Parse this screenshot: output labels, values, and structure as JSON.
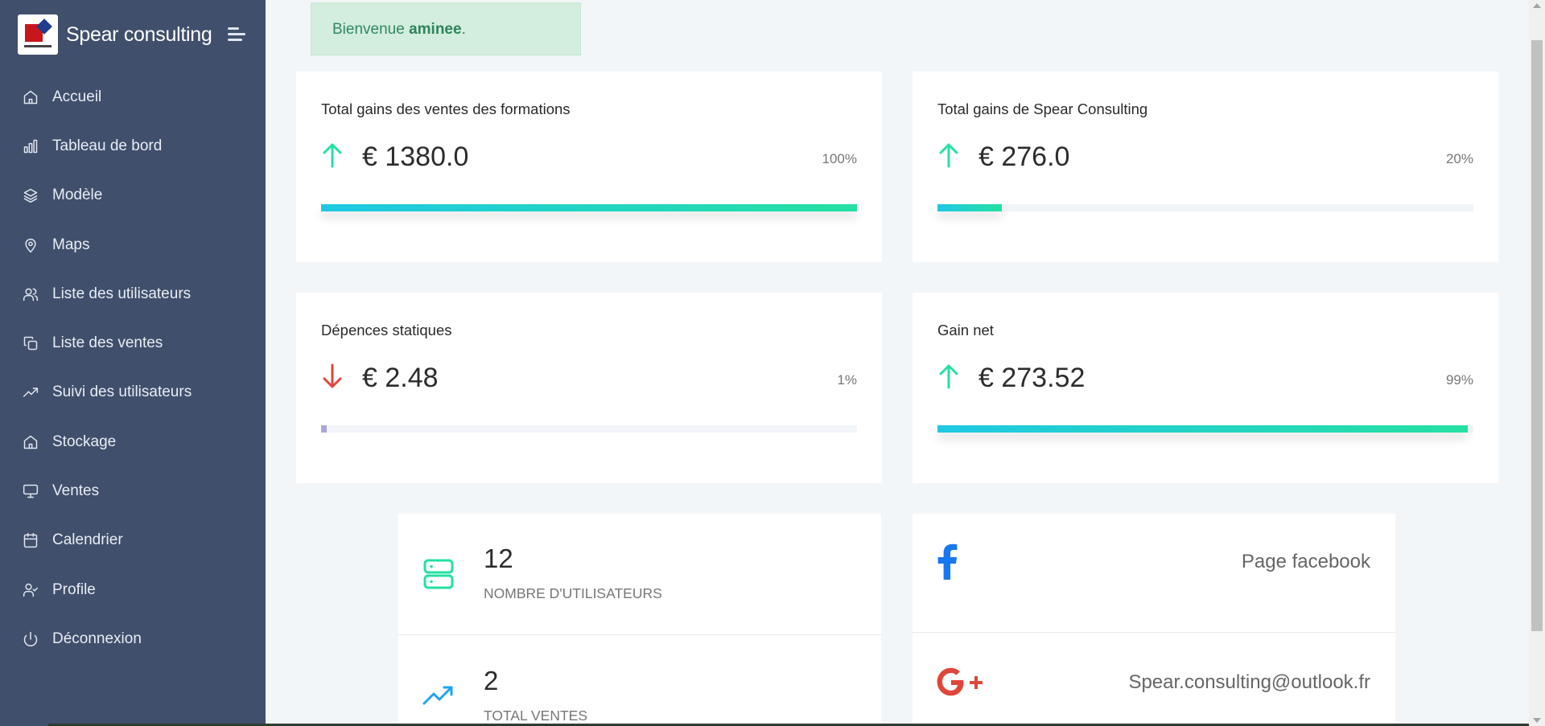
{
  "brand": {
    "name": "Spear consulting"
  },
  "sidebar": {
    "items": [
      {
        "label": "Accueil",
        "icon": "home-icon"
      },
      {
        "label": "Tableau de bord",
        "icon": "bar-chart-icon"
      },
      {
        "label": "Modèle",
        "icon": "layers-icon"
      },
      {
        "label": "Maps",
        "icon": "map-pin-icon"
      },
      {
        "label": "Liste des utilisateurs",
        "icon": "users-icon"
      },
      {
        "label": "Liste des ventes",
        "icon": "copy-icon"
      },
      {
        "label": "Suivi des utilisateurs",
        "icon": "trending-up-icon"
      },
      {
        "label": "Stockage",
        "icon": "home-icon"
      },
      {
        "label": "Ventes",
        "icon": "monitor-icon"
      },
      {
        "label": "Calendrier",
        "icon": "calendar-icon"
      },
      {
        "label": "Profile",
        "icon": "user-check-icon"
      },
      {
        "label": "Déconnexion",
        "icon": "power-icon"
      }
    ]
  },
  "welcome": {
    "prefix": "Bienvenue",
    "user": "aminee",
    "suffix": "."
  },
  "stats": [
    {
      "title": "Total gains des ventes des formations",
      "value": "€ 1380.0",
      "percent": "100%",
      "progress": 100,
      "trend": "up"
    },
    {
      "title": "Total gains de Spear Consulting",
      "value": "€ 276.0",
      "percent": "20%",
      "progress": 12,
      "trend": "up"
    },
    {
      "title": "Dépences statiques",
      "value": "€ 2.48",
      "percent": "1%",
      "progress": 1,
      "trend": "down"
    },
    {
      "title": "Gain net",
      "value": "€ 273.52",
      "percent": "99%",
      "progress": 99,
      "trend": "up"
    }
  ],
  "info": {
    "users": {
      "value": "12",
      "label": "NOMBRE D'UTILISATEURS"
    },
    "sales": {
      "value": "2",
      "label": "TOTAL VENTES"
    }
  },
  "social": {
    "facebook": {
      "label": "Page facebook",
      "icon": "facebook-icon"
    },
    "google": {
      "label": "Spear.consulting@outlook.fr",
      "icon": "google-plus-icon"
    }
  },
  "colors": {
    "sidebar": "#404f6b",
    "accent_teal": "#25e0a2",
    "accent_cyan": "#1ec8e3",
    "down_red": "#e0463b",
    "facebook": "#1877f2",
    "google": "#e0463b"
  }
}
